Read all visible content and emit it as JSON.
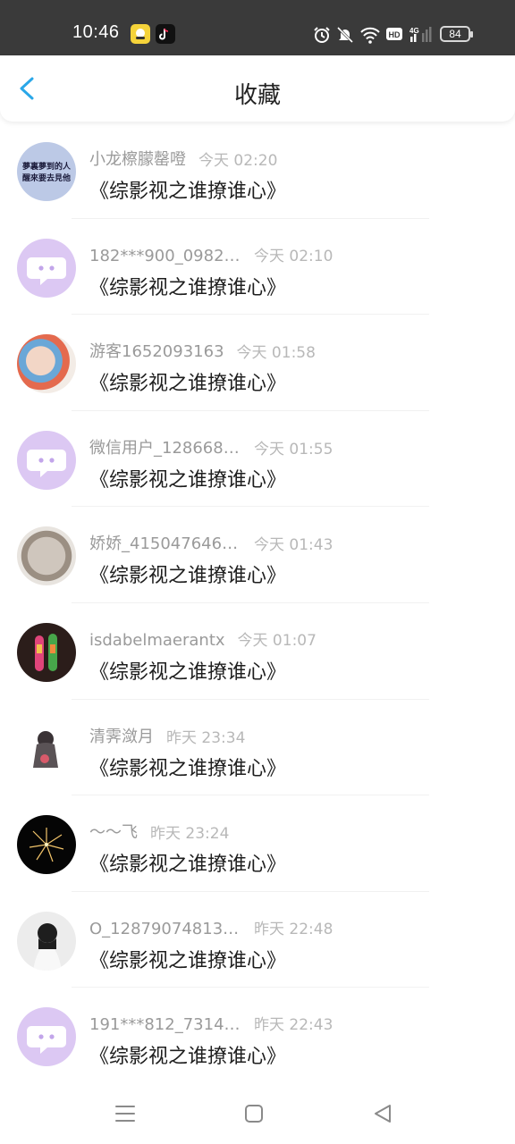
{
  "status_bar": {
    "time": "10:46",
    "battery": "84",
    "icons": [
      "app-icon-yellow",
      "tiktok-icon",
      "alarm-icon",
      "mute-icon",
      "wifi-icon",
      "hd-icon",
      "signal-4g-icon",
      "battery-icon"
    ]
  },
  "header": {
    "title": "收藏",
    "back_icon": "chevron-left-icon",
    "accent_color": "#2aa7e8"
  },
  "items": [
    {
      "user": "小龙檫朦罄噔",
      "time": "今天 02:20",
      "title": "《综影视之谁撩谁心》",
      "avatar": "text-avatar"
    },
    {
      "user": "182***900_09821...",
      "time": "今天 02:10",
      "title": "《综影视之谁撩谁心》",
      "avatar": "chat-bubble-avatar"
    },
    {
      "user": "游客1652093163",
      "time": "今天 01:58",
      "title": "《综影视之谁撩谁心》",
      "avatar": "photo-avatar"
    },
    {
      "user": "微信用户_1286681...",
      "time": "今天 01:55",
      "title": "《综影视之谁撩谁心》",
      "avatar": "chat-bubble-avatar"
    },
    {
      "user": "娇娇_4150476462...",
      "time": "今天 01:43",
      "title": "《综影视之谁撩谁心》",
      "avatar": "photo-avatar"
    },
    {
      "user": "isdabelmaerantx",
      "time": "今天 01:07",
      "title": "《综影视之谁撩谁心》",
      "avatar": "photo-avatar"
    },
    {
      "user": "清霁潋月",
      "time": "昨天 23:34",
      "title": "《综影视之谁撩谁心》",
      "avatar": "photo-avatar"
    },
    {
      "user": "～～飞",
      "time": "昨天 23:24",
      "title": "《综影视之谁撩谁心》",
      "avatar": "photo-avatar"
    },
    {
      "user": "O_128790748136...",
      "time": "昨天 22:48",
      "title": "《综影视之谁撩谁心》",
      "avatar": "photo-avatar"
    },
    {
      "user": "191***812_73145...",
      "time": "昨天 22:43",
      "title": "《综影视之谁撩谁心》",
      "avatar": "chat-bubble-avatar"
    }
  ],
  "avatar_text": {
    "line1": "夢裏夢到的人",
    "line2": "醒來要去見他"
  },
  "nav_bar": {
    "icons": [
      "menu-icon",
      "home-icon",
      "back-icon"
    ]
  }
}
